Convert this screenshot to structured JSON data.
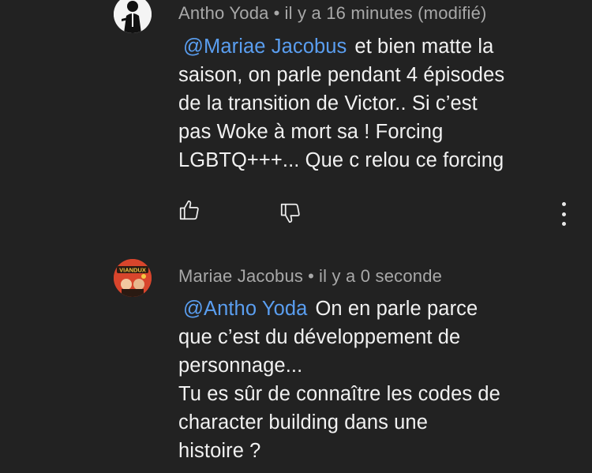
{
  "comments": [
    {
      "author": "Antho Yoda",
      "separator": "•",
      "timestamp": "il y a 16 minutes (modifié)",
      "mention": "@Mariae Jacobus",
      "lines": [
        "et bien matte la",
        "saison, on parle pendant 4 épisodes",
        "de la transition de Victor.. Si c’est",
        "pas Woke à mort sa ! Forcing",
        "LGBTQ+++... Que c relou ce forcing"
      ],
      "actions": [
        "like-icon",
        "dislike-icon",
        "more-vertical-icon"
      ]
    },
    {
      "author": "Mariae Jacobus",
      "separator": "•",
      "timestamp": "il y a 0 seconde",
      "mention": "@Antho Yoda",
      "lines": [
        "On en parle parce",
        "que c’est du développement de",
        "personnage...",
        "Tu es sûr de connaître les codes de",
        "character building dans une",
        "histoire ?"
      ],
      "avatar_text": "VIANDUX"
    }
  ],
  "colors": {
    "background": "#222222",
    "text": "#f1f1f1",
    "meta": "#a8a8a8",
    "mention": "#5a9ef0"
  }
}
